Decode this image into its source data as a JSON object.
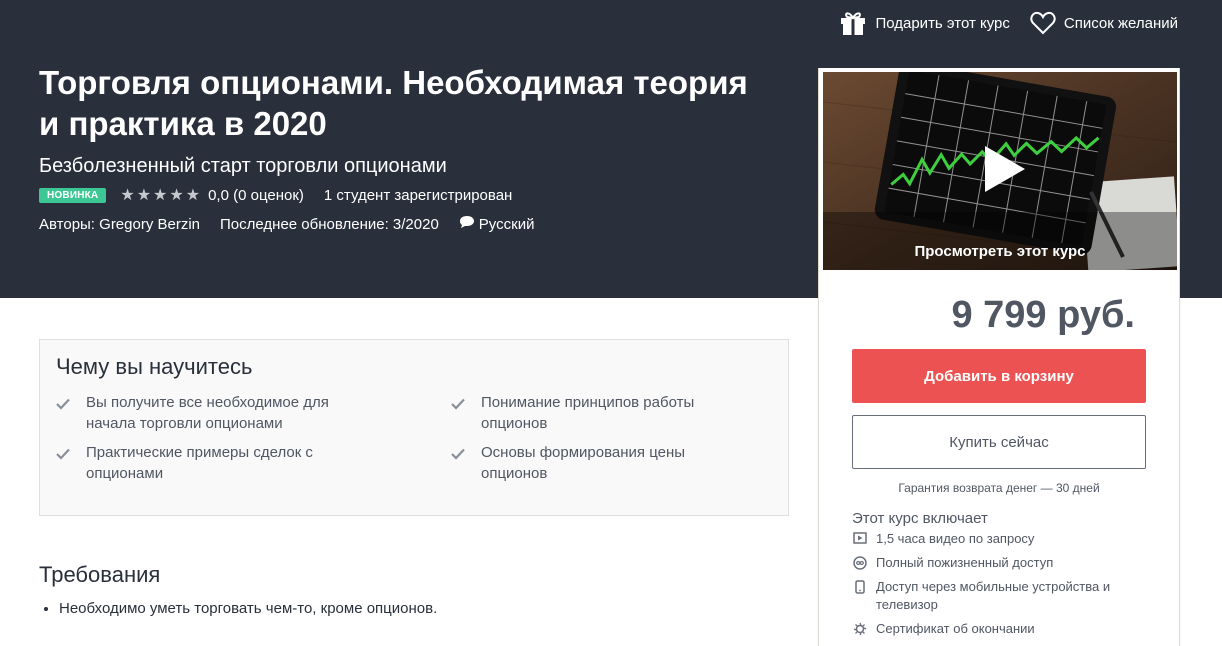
{
  "header": {
    "gift_label": "Подарить этот курс",
    "wishlist_label": "Список желаний"
  },
  "course": {
    "title": "Торговля опционами. Необходимая теория и практика в 2020",
    "subtitle": "Безболезненный старт торговли опционами",
    "badge": "НОВИНКА",
    "stars_filled": 0,
    "stars_total": 5,
    "rating_text": "0,0 (0 оценок)",
    "students_text": "1 студент зарегистрирован",
    "authors_text": "Авторы: Gregory Berzin",
    "updated_text": "Последнее обновление: 3/2020",
    "language": "Русский"
  },
  "sidebar": {
    "preview_label": "Просмотреть этот курс",
    "price": "9 799 руб.",
    "add_to_cart": "Добавить в корзину",
    "buy_now": "Купить сейчас",
    "guarantee": "Гарантия возврата денег — 30 дней",
    "includes_title": "Этот курс включает",
    "includes": [
      {
        "icon": "video-icon",
        "text": "1,5 часа видео по запросу"
      },
      {
        "icon": "infinity-icon",
        "text": "Полный пожизненный доступ"
      },
      {
        "icon": "mobile-icon",
        "text": "Доступ через мобильные устройства и телевизор"
      },
      {
        "icon": "certificate-icon",
        "text": "Сертификат об окончании"
      }
    ]
  },
  "learn": {
    "title": "Чему вы научитесь",
    "items": [
      "Вы получите все необходимое для начала торговли опционами",
      "Понимание принципов работы опционов",
      "Практические примеры сделок с опционами",
      "Основы формирования цены опционов"
    ]
  },
  "requirements": {
    "title": "Требования",
    "items": [
      "Необходимо уметь торговать чем-то, кроме опционов."
    ]
  },
  "colors": {
    "hero_bg": "#29303b",
    "badge": "#3dc794",
    "cart_button": "#ec5252"
  }
}
